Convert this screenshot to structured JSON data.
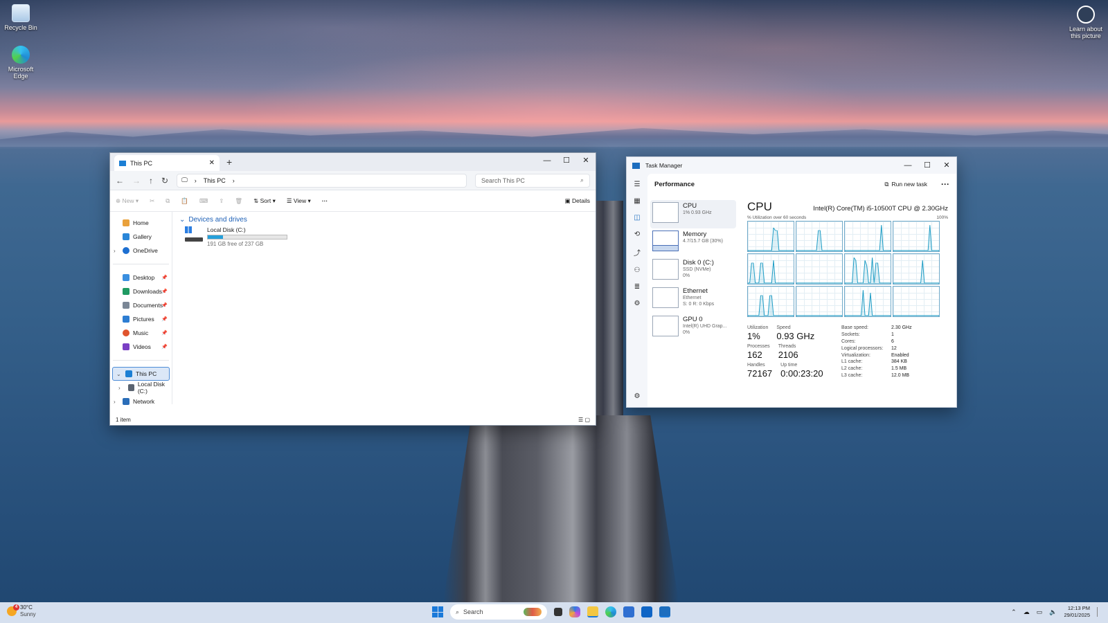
{
  "desktop": {
    "recycle_bin": "Recycle Bin",
    "edge": "Microsoft Edge",
    "learn_picture": "Learn about this picture"
  },
  "explorer": {
    "tab_title": "This PC",
    "breadcrumb": "This PC",
    "search_placeholder": "Search This PC",
    "toolbar": {
      "new": "New",
      "sort": "Sort",
      "view": "View",
      "details": "Details"
    },
    "nav": {
      "home": "Home",
      "gallery": "Gallery",
      "onedrive": "OneDrive",
      "desktop": "Desktop",
      "downloads": "Downloads",
      "documents": "Documents",
      "pictures": "Pictures",
      "music": "Music",
      "videos": "Videos",
      "this_pc": "This PC",
      "local_disk": "Local Disk (C:)",
      "network": "Network"
    },
    "group_label": "Devices and drives",
    "drive": {
      "name": "Local Disk (C:)",
      "free_text": "191 GB free of 237 GB",
      "used_fraction": 0.194
    },
    "status": "1 item"
  },
  "taskmgr": {
    "title": "Task Manager",
    "section": "Performance",
    "run_new_task": "Run new task",
    "list": [
      {
        "name": "CPU",
        "sub1": "1% 0.93 GHz",
        "sub2": ""
      },
      {
        "name": "Memory",
        "sub1": "4.7/15.7 GB (30%)",
        "sub2": ""
      },
      {
        "name": "Disk 0 (C:)",
        "sub1": "SSD (NVMe)",
        "sub2": "0%"
      },
      {
        "name": "Ethernet",
        "sub1": "Ethernet",
        "sub2": "S: 0 R: 0 Kbps"
      },
      {
        "name": "GPU 0",
        "sub1": "Intel(R) UHD Grap...",
        "sub2": "0%"
      }
    ],
    "cpu_title": "CPU",
    "cpu_model": "Intel(R) Core(TM) i5-10500T CPU @ 2.30GHz",
    "util_label": "% Utilization over 60 seconds",
    "util_max": "100%",
    "stats": {
      "utilization_label": "Utilization",
      "utilization": "1%",
      "speed_label": "Speed",
      "speed": "0.93 GHz",
      "processes_label": "Processes",
      "processes": "162",
      "threads_label": "Threads",
      "threads": "2106",
      "handles_label": "Handles",
      "handles": "72167",
      "uptime_label": "Up time",
      "uptime": "0:00:23:20"
    },
    "specs": [
      [
        "Base speed:",
        "2.30 GHz"
      ],
      [
        "Sockets:",
        "1"
      ],
      [
        "Cores:",
        "6"
      ],
      [
        "Logical processors:",
        "12"
      ],
      [
        "Virtualization:",
        "Enabled"
      ],
      [
        "L1 cache:",
        "384 KB"
      ],
      [
        "L2 cache:",
        "1.5 MB"
      ],
      [
        "L3 cache:",
        "12.0 MB"
      ]
    ]
  },
  "taskbar": {
    "temp": "30°C",
    "weather": "Sunny",
    "weather_badge": "4",
    "search": "Search",
    "time": "12:13 PM",
    "date": "29/01/2025"
  },
  "colors": {
    "accent": "#1a79d9",
    "cpu_graph": "#1b9bc4",
    "drive_bar": "#26a0da"
  }
}
